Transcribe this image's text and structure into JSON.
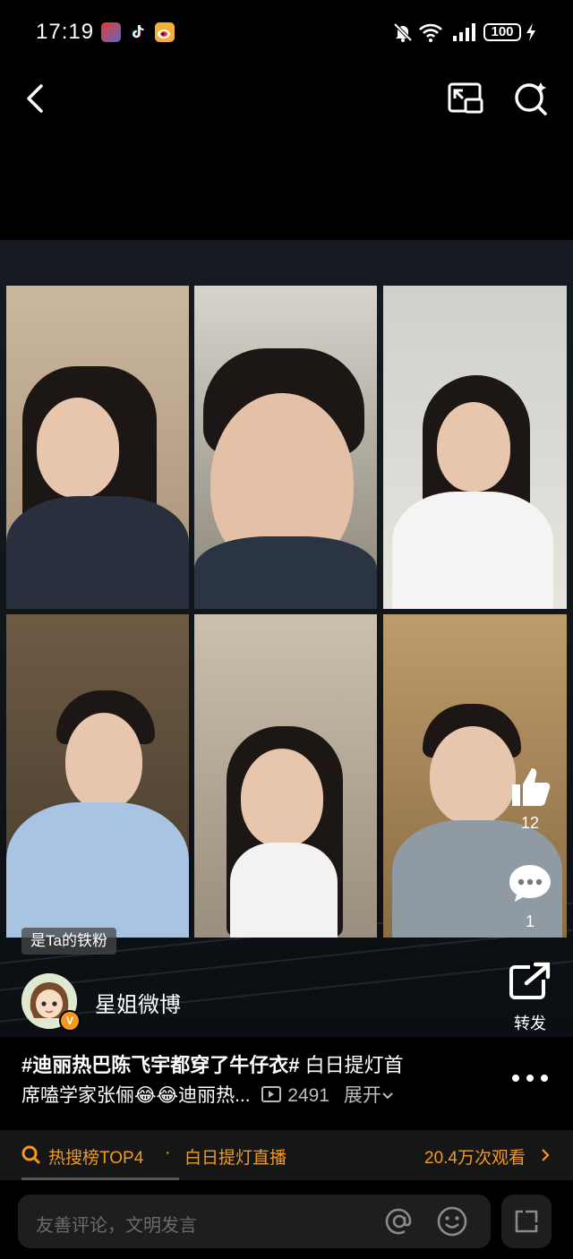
{
  "status_bar": {
    "time": "17:19",
    "battery": "100",
    "app_icons": [
      "game-app-icon",
      "tiktok-icon",
      "weibo-icon"
    ],
    "indicator_icons": [
      "mute-bell-icon",
      "wifi-icon",
      "signal-icon",
      "battery-icon",
      "charging-icon"
    ]
  },
  "header": {
    "back_icon": "back-arrow-icon",
    "pip_icon": "picture-in-picture-icon",
    "search_icon": "search-icon"
  },
  "video": {
    "badge": "是Ta的铁粉",
    "like_count": "12",
    "comment_count": "1",
    "share_label": "转发"
  },
  "post": {
    "author": "星姐微博",
    "caption_line1_tag": "#迪丽热巴陈飞宇都穿了牛仔衣#",
    "caption_line1_rest": " 白日提灯首",
    "caption_line2": "席嗑学家张俪😂😂迪丽热...",
    "view_count": "2491",
    "expand_label": "展开"
  },
  "trend": {
    "rank": "热搜榜TOP4",
    "separator": "·",
    "topic": "白日提灯直播",
    "views": "20.4万次观看"
  },
  "comment": {
    "placeholder": "友善评论，文明发言"
  },
  "colors": {
    "background": "#000000",
    "trend_orange": "#f39a1e",
    "accent_orange": "#f39a1e"
  }
}
